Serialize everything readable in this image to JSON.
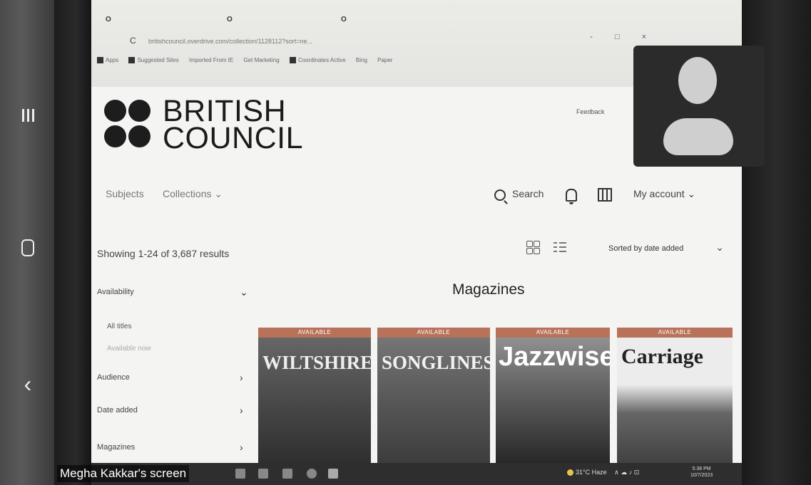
{
  "browser": {
    "tabs": [
      {
        "title": "O"
      },
      {
        "title": "O"
      }
    ],
    "url": "britishcouncil.overdrive.com/collection/1128112?sort=ne...",
    "bookmarks": [
      "Apps",
      "Suggested Sites",
      "Imported From IE",
      "Get Marketing",
      "Coordinates Active",
      "Bing",
      "Paper"
    ]
  },
  "header": {
    "logo_line1": "BRITISH",
    "logo_line2": "COUNCIL",
    "feedback": "Feedback"
  },
  "nav": {
    "subjects": "Subjects",
    "collections": "Collections ⌄",
    "search": "Search",
    "account": "My account ⌄"
  },
  "results": {
    "summary": "Showing 1-24 of 3,687 results",
    "sort_label": "Sorted by date added"
  },
  "filters": {
    "availability": "Availability",
    "all_titles": "All titles",
    "available_now": "Available now",
    "audience": "Audience",
    "date_added": "Date added",
    "magazines": "Magazines"
  },
  "section_title": "Magazines",
  "covers": [
    {
      "badge": "AVAILABLE",
      "title": "WILTSHIRE"
    },
    {
      "badge": "AVAILABLE",
      "title": "SONGLINES"
    },
    {
      "badge": "AVAILABLE",
      "title": "Jazzwise"
    },
    {
      "badge": "AVAILABLE",
      "title": "Carriage"
    }
  ],
  "share": {
    "label": "Megha Kakkar's screen"
  },
  "tray": {
    "weather": "31°C Haze",
    "time": "5:38 PM",
    "date": "10/7/2023"
  },
  "colors": {
    "badge": "#b9725a",
    "logo": "#1d1d1d"
  }
}
